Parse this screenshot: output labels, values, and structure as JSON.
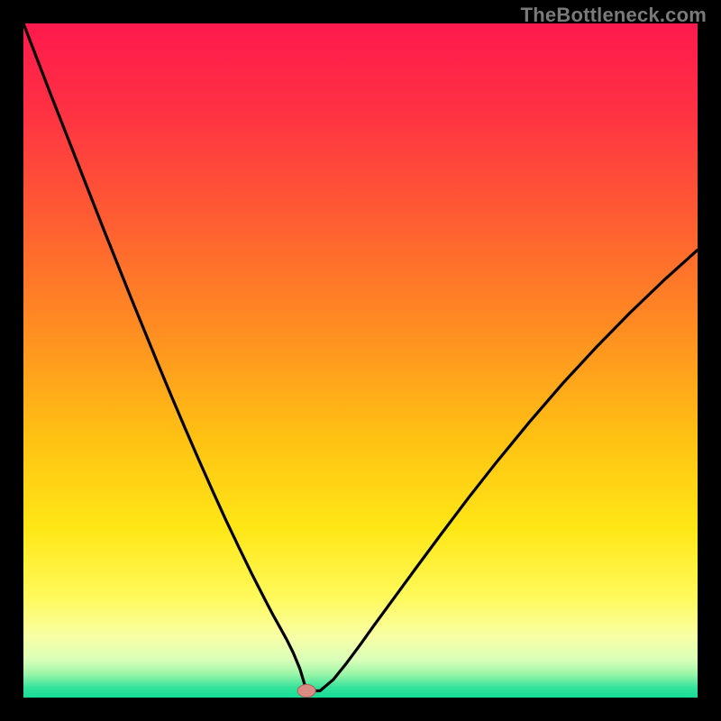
{
  "watermark": "TheBottleneck.com",
  "colors": {
    "frame": "#000000",
    "watermark": "#7a7a7a",
    "curve": "#000000",
    "marker_fill": "#d98b84",
    "marker_stroke": "#b25f57",
    "gradient_stops": [
      {
        "offset": 0.0,
        "color": "#ff1a4d"
      },
      {
        "offset": 0.12,
        "color": "#ff2f44"
      },
      {
        "offset": 0.28,
        "color": "#ff5a33"
      },
      {
        "offset": 0.45,
        "color": "#ff8c22"
      },
      {
        "offset": 0.62,
        "color": "#ffc313"
      },
      {
        "offset": 0.75,
        "color": "#ffe716"
      },
      {
        "offset": 0.85,
        "color": "#fff95a"
      },
      {
        "offset": 0.91,
        "color": "#f8ffa6"
      },
      {
        "offset": 0.945,
        "color": "#d8ffb8"
      },
      {
        "offset": 0.965,
        "color": "#9bf5a8"
      },
      {
        "offset": 0.985,
        "color": "#34e29a"
      },
      {
        "offset": 1.0,
        "color": "#14dd97"
      }
    ]
  },
  "chart_data": {
    "type": "line",
    "title": "",
    "xlabel": "",
    "ylabel": "",
    "xlim": [
      0,
      100
    ],
    "ylim": [
      0,
      100
    ],
    "marker": {
      "x": 42,
      "y": 1
    },
    "series": [
      {
        "name": "bottleneck-curve",
        "x": [
          0,
          2,
          4,
          6,
          8,
          10,
          12,
          14,
          16,
          18,
          20,
          22,
          24,
          26,
          28,
          30,
          32,
          34,
          36,
          37,
          38,
          39,
          40,
          41,
          42,
          43,
          44,
          46,
          48,
          50,
          52,
          55,
          58,
          62,
          66,
          70,
          75,
          80,
          85,
          90,
          95,
          100
        ],
        "y": [
          100,
          94.8,
          89.6,
          84.5,
          79.4,
          74.3,
          69.2,
          64.2,
          59.2,
          54.3,
          49.4,
          44.6,
          39.9,
          35.3,
          30.8,
          26.4,
          22.2,
          18.1,
          14.2,
          12.3,
          10.5,
          8.7,
          6.7,
          4.3,
          1.0,
          1.0,
          1.0,
          2.7,
          5.2,
          7.9,
          10.7,
          14.8,
          18.9,
          24.3,
          29.6,
          34.7,
          40.8,
          46.6,
          52.0,
          57.1,
          61.9,
          66.4
        ]
      }
    ]
  }
}
